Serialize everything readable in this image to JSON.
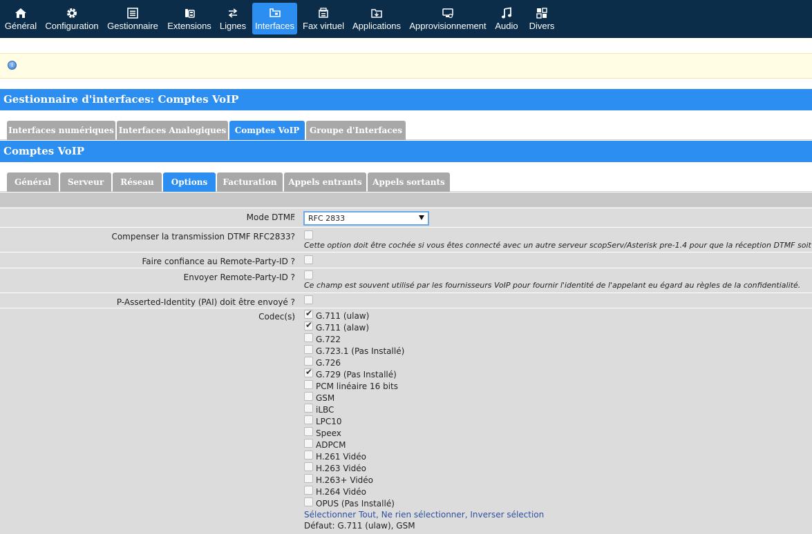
{
  "nav": {
    "items": [
      {
        "label": "Général",
        "icon": "home-icon"
      },
      {
        "label": "Configuration",
        "icon": "gear-icon"
      },
      {
        "label": "Gestionnaire",
        "icon": "list-icon"
      },
      {
        "label": "Extensions",
        "icon": "phone-icon"
      },
      {
        "label": "Lignes",
        "icon": "lines-icon"
      },
      {
        "label": "Interfaces",
        "icon": "interfaces-icon",
        "active": true
      },
      {
        "label": "Fax virtuel",
        "icon": "fax-icon"
      },
      {
        "label": "Applications",
        "icon": "applications-icon"
      },
      {
        "label": "Approvisionnement",
        "icon": "provisioning-icon"
      },
      {
        "label": "Audio",
        "icon": "music-icon"
      },
      {
        "label": "Divers",
        "icon": "grid-icon"
      }
    ]
  },
  "page_title": "Gestionnaire d'interfaces:  Comptes VoIP",
  "main_tabs": [
    "Interfaces numériques",
    "Interfaces Analogiques",
    "Comptes VoIP",
    "Groupe d'Interfaces"
  ],
  "main_tab_active": "Comptes VoIP",
  "section_title": "Comptes VoIP",
  "sub_tabs": [
    "Général",
    "Serveur",
    "Réseau",
    "Options",
    "Facturation",
    "Appels entrants",
    "Appels sortants"
  ],
  "sub_tab_active": "Options",
  "form": {
    "dtmf_label": "Mode DTMF",
    "dtmf_value": "RFC 2833",
    "compensate_label": "Compenser la transmission DTMF RFC2833?",
    "compensate_note": "Cette option doit être cochée si vous êtes connecté avec un autre serveur scopServ/Asterisk pre-1.4 pour que la réception DTMF soit optimale.",
    "trust_rpid_label": "Faire confiance au Remote-Party-ID ?",
    "send_rpid_label": "Envoyer Remote-Party-ID ?",
    "send_rpid_note": "Ce champ est souvent utilisé par les fournisseurs VoIP pour fournir l'identité de l'appelant eu égard au règles de la confidentialité.",
    "pai_label": "P-Asserted-Identity (PAI) doit être envoyé ?",
    "codecs_label": "Codec(s)",
    "colon": ":",
    "codecs": [
      {
        "name": "G.711 (ulaw)",
        "checked": true
      },
      {
        "name": "G.711 (alaw)",
        "checked": true
      },
      {
        "name": "G.722",
        "checked": false
      },
      {
        "name": "G.723.1 (Pas Installé)",
        "checked": false
      },
      {
        "name": "G.726",
        "checked": false
      },
      {
        "name": "G.729 (Pas Installé)",
        "checked": true
      },
      {
        "name": "PCM linéaire 16 bits",
        "checked": false
      },
      {
        "name": "GSM",
        "checked": false
      },
      {
        "name": "iLBC",
        "checked": false
      },
      {
        "name": "LPC10",
        "checked": false
      },
      {
        "name": "Speex",
        "checked": false
      },
      {
        "name": "ADPCM",
        "checked": false
      },
      {
        "name": "H.261 Vidéo",
        "checked": false
      },
      {
        "name": "H.263 Vidéo",
        "checked": false
      },
      {
        "name": "H.263+ Vidéo",
        "checked": false
      },
      {
        "name": "H.264 Vidéo",
        "checked": false
      },
      {
        "name": "OPUS (Pas Installé)",
        "checked": false
      }
    ],
    "select_all": "Sélectionner Tout",
    "select_none": "Ne rien sélectionner",
    "invert": "Inverser sélection",
    "default_text": "Défaut: G.711 (ulaw), GSM"
  },
  "colors": {
    "nav_bg": "#0c2d49",
    "accent": "#2c8ef0",
    "tab_inactive": "#a8a8a8",
    "form_bg": "#dcdcdc"
  }
}
